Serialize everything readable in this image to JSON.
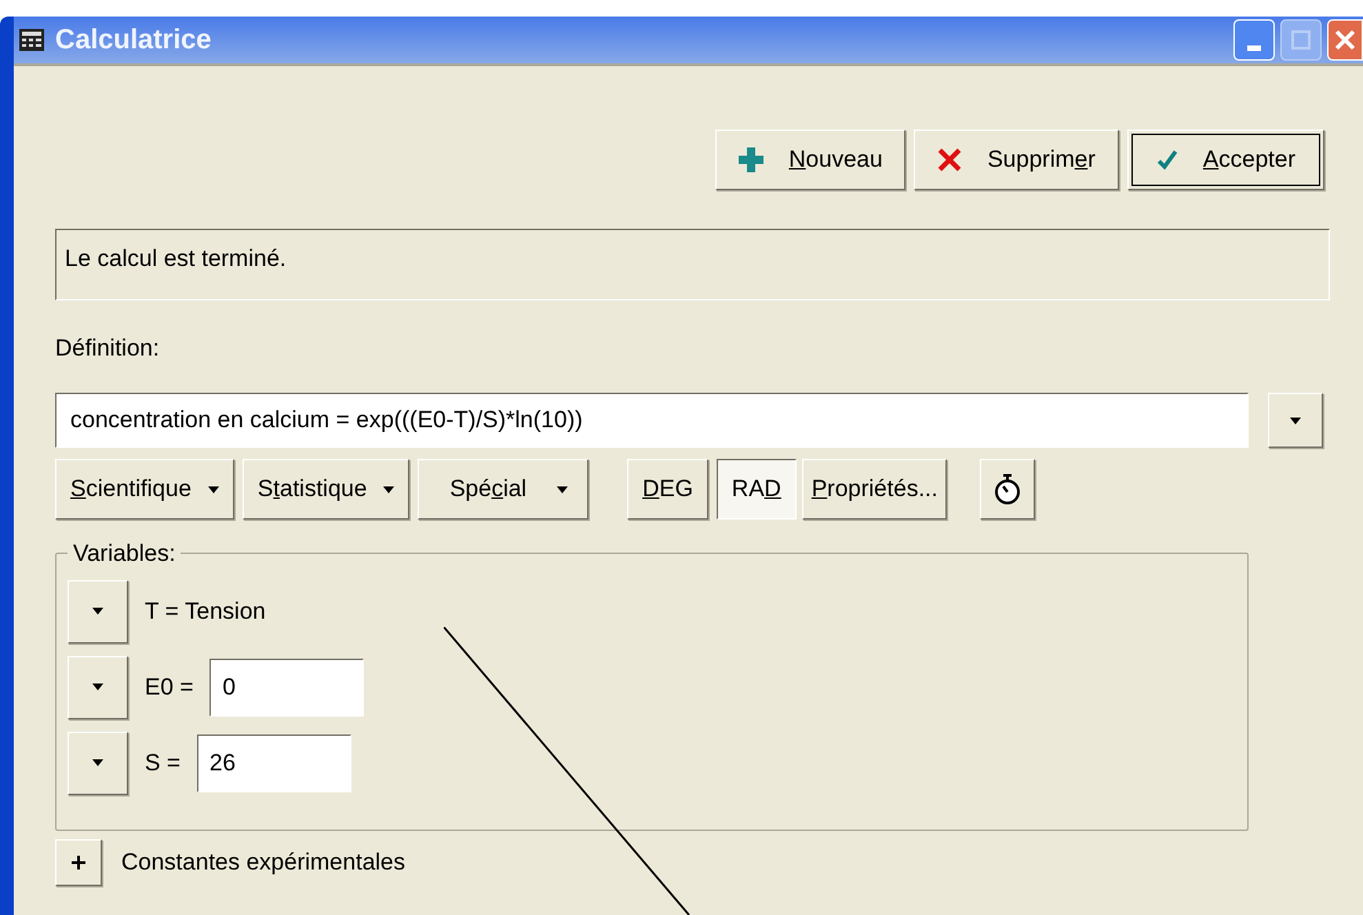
{
  "window": {
    "title": "Calculatrice"
  },
  "actions": [
    {
      "kind": "add",
      "key": "N",
      "after": "ouveau"
    },
    {
      "kind": "delete",
      "before": "Supprim",
      "key": "e",
      "after": "r"
    },
    {
      "kind": "accept",
      "key": "A",
      "after": "ccepter"
    }
  ],
  "status": "Le calcul est terminé.",
  "definition": {
    "label": "Définition:",
    "value": "concentration en calcium = exp(((E0-T)/S)*ln(10))"
  },
  "toolbar": [
    {
      "kind": "menu",
      "key": "S",
      "after": "cientifique"
    },
    {
      "kind": "menu",
      "before": "S",
      "key": "t",
      "after": "atistique"
    },
    {
      "kind": "menu",
      "before": "Spé",
      "key": "c",
      "after": "ial"
    },
    {
      "kind": "toggle",
      "key": "D",
      "after": "EG",
      "selected": false
    },
    {
      "kind": "toggle",
      "before": "RA",
      "key": "D",
      "selected": true
    },
    {
      "kind": "plain",
      "key": "P",
      "after": "ropriétés..."
    }
  ],
  "variables": {
    "label": "Variables:",
    "items": [
      {
        "kind": "text",
        "name": "T = Tension"
      },
      {
        "kind": "input",
        "name": "E0 =",
        "value": "0"
      },
      {
        "kind": "input",
        "name": "S =",
        "value": "26"
      }
    ]
  },
  "constants": {
    "label": "Constantes expérimentales",
    "expanded": false
  }
}
